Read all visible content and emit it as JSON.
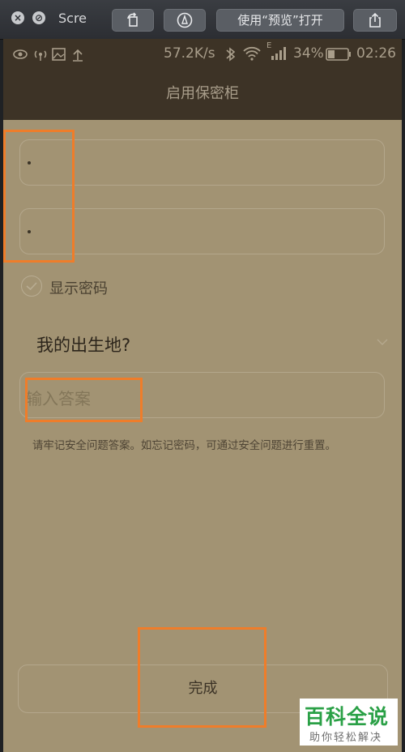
{
  "window": {
    "title": "Scre",
    "open_with_preview_label": "使用“预览”打开"
  },
  "status_bar": {
    "speed": "57.2K/s",
    "battery": "34%",
    "time": "02:26",
    "network_mark": "E"
  },
  "app_bar": {
    "title": "启用保密柜"
  },
  "form": {
    "password_dot": "•",
    "confirm_dot": "•",
    "show_password_label": "显示密码",
    "security_question": "我的出生地?",
    "answer_placeholder": "输入答案",
    "hint": "请牢记安全问题答案。如忘记密码，可通过安全问题进行重置。",
    "done_label": "完成"
  },
  "watermark": {
    "title": "百科全说",
    "subtitle": "助你轻松解决"
  },
  "colors": {
    "screen_bg": "#a29373",
    "bar_bg": "#3d3326",
    "highlight": "#ef7d2a",
    "watermark_green": "#2aa046"
  }
}
